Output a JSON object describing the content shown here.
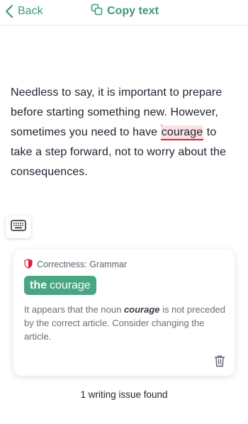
{
  "header": {
    "back_label": "Back",
    "copy_label": "Copy text"
  },
  "document": {
    "text_before": "Needless to say, it is important to prepare before starting something new. However, sometimes you need to have ",
    "flagged_word": "courage",
    "text_after": " to take a step forward, not to worry about the consequences."
  },
  "card": {
    "category": "Correctness: Grammar",
    "suggestion_bold": "the",
    "suggestion_word": "courage",
    "desc_before": "It appears that the noun ",
    "desc_word": "courage",
    "desc_after": " is not preceded by the correct article. Consider changing the article."
  },
  "footer": {
    "issues_text": "1 writing issue found"
  },
  "colors": {
    "accent": "#3f9a7c",
    "suggestion_bg": "#4aa582",
    "error": "#d9213f",
    "highlight": "#fbe1e4"
  },
  "icons": [
    "chevron-left-icon",
    "copy-icon",
    "keyboard-icon",
    "shield-icon",
    "trash-icon"
  ]
}
